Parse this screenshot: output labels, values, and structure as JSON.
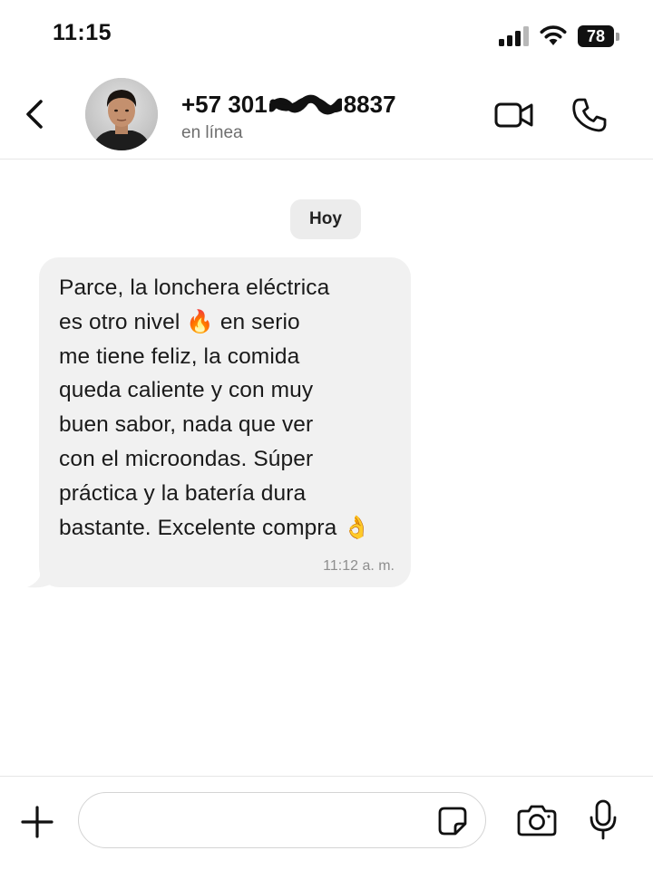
{
  "status_bar": {
    "time": "11:15",
    "battery": "78",
    "icons": [
      "signal-icon",
      "wifi-icon",
      "battery-icon"
    ]
  },
  "header": {
    "back_icon": "chevron-left-icon",
    "contact_name_prefix": "+57 301",
    "contact_name_suffix": "8837",
    "status": "en línea",
    "video_icon": "video-camera-icon",
    "phone_icon": "phone-icon"
  },
  "chat": {
    "date_label": "Hoy",
    "messages": [
      {
        "text": "Parce, la lonchera eléctrica\nes otro nivel 🔥 en serio\nme tiene feliz, la comida\nqueda caliente y con muy\nbuen sabor, nada que ver\ncon el microondas. Súper\npráctica y la batería dura\nbastante. Excelente compra 👌",
        "time": "11:12 a. m.",
        "direction": "incoming"
      }
    ]
  },
  "input_bar": {
    "plus_icon": "plus-icon",
    "input_value": "",
    "sticker_icon": "sticker-icon",
    "camera_icon": "camera-icon",
    "mic_icon": "microphone-icon"
  },
  "colors": {
    "background": "#ffffff",
    "bubble_incoming": "#f1f1f1",
    "date_chip": "#ececec",
    "secondary_text": "#6e6e6e",
    "timestamp": "#8e8e8e"
  }
}
